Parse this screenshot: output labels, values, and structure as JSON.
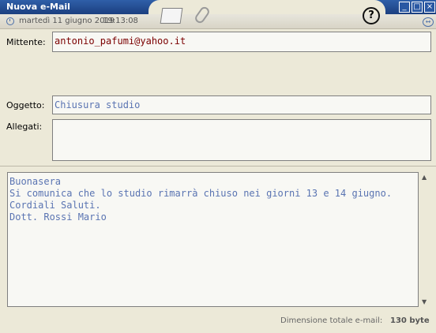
{
  "window": {
    "title": "Nuova e-Mail"
  },
  "header": {
    "date": "martedì 11 giugno 2019",
    "time": "19:13:08"
  },
  "labels": {
    "sender": "Mittente:",
    "subject": "Oggetto:",
    "attachments": "Allegati:"
  },
  "fields": {
    "sender": "antonio_pafumi@yahoo.it",
    "subject": "Chiusura studio",
    "attachments": ""
  },
  "message": {
    "lines": [
      "Buonasera",
      "Si comunica che lo studio rimarrà chiuso nei giorni 13 e 14 giugno.",
      "Cordiali Saluti.",
      "Dott. Rossi Mario"
    ]
  },
  "footer": {
    "size_label": "Dimensione totale e-mail:",
    "size_value": "130 byte"
  },
  "icons": [
    "clock-icon",
    "envelope-icon",
    "paperclip-icon",
    "help-icon",
    "navigation-icon",
    "minimize-icon",
    "maximize-icon",
    "close-icon"
  ]
}
